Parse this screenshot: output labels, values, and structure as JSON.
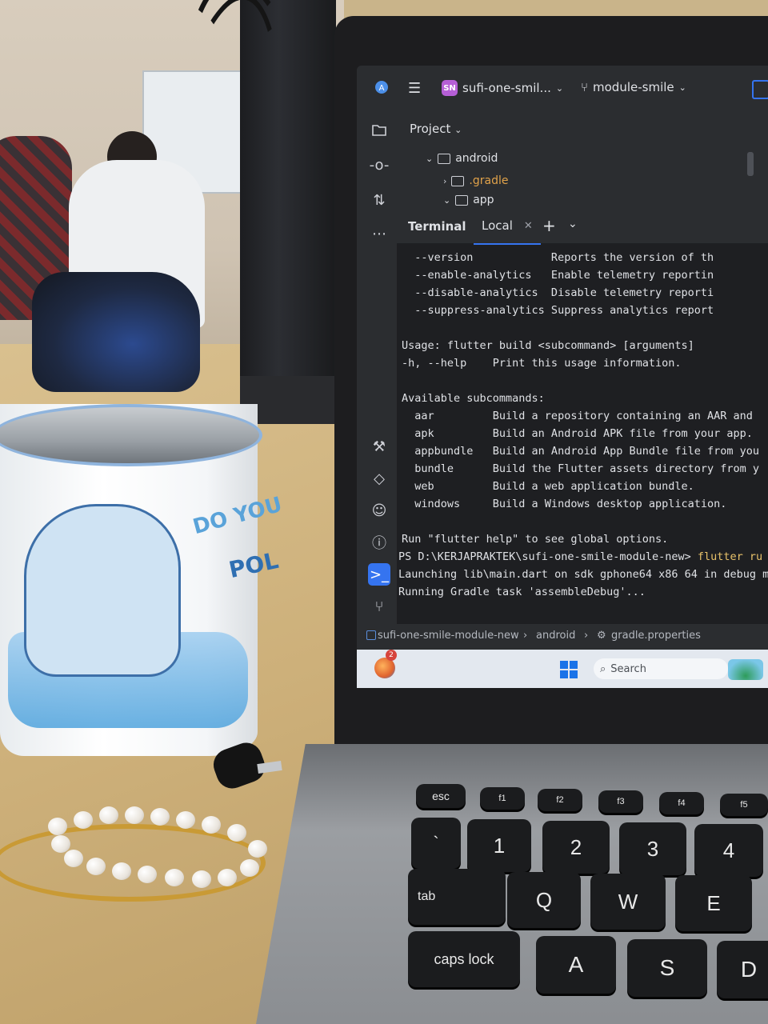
{
  "topbar": {
    "project_initials": "SN",
    "project_name": "sufi-one-smil...",
    "branch": "module-smile"
  },
  "project_panel": {
    "title": "Project",
    "tree": [
      "android",
      ".gradle",
      "app"
    ]
  },
  "terminal": {
    "title": "Terminal",
    "tab_label": "Local",
    "lines": [
      {
        "text": "  --version            Reports the version of th"
      },
      {
        "text": "  --enable-analytics   Enable telemetry reportin"
      },
      {
        "text": "  --disable-analytics  Disable telemetry reporti"
      },
      {
        "text": "  --suppress-analytics Suppress analytics report"
      },
      {
        "text": ""
      },
      {
        "text": "Usage: flutter build <subcommand> [arguments]"
      },
      {
        "text": "-h, --help    Print this usage information."
      },
      {
        "text": ""
      },
      {
        "text": "Available subcommands:"
      },
      {
        "text": "  aar         Build a repository containing an AAR and"
      },
      {
        "text": "  apk         Build an Android APK file from your app."
      },
      {
        "text": "  appbundle   Build an Android App Bundle file from you"
      },
      {
        "text": "  bundle      Build the Flutter assets directory from y"
      },
      {
        "text": "  web         Build a web application bundle."
      },
      {
        "text": "  windows     Build a Windows desktop application."
      },
      {
        "text": ""
      },
      {
        "text": "Run \"flutter help\" to see global options."
      }
    ],
    "prompt": "PS D:\\KERJAPRAKTEK\\sufi-one-smile-module-new>",
    "command": "flutter ru",
    "launching": "Launching lib\\main.dart on sdk gphone64 x86 64 in debug m",
    "running": "Running Gradle task 'assembleDebug'..."
  },
  "statusbar": {
    "crumbs": [
      "sufi-one-smile-module-new",
      "android",
      "gradle.properties"
    ]
  },
  "taskbar": {
    "notification_count": "2",
    "search_placeholder": "Search"
  },
  "mug": {
    "text_line1": "DO YOU",
    "text_line2": "POL"
  },
  "keyboard": {
    "row_fn": [
      "esc",
      "f1",
      "f2",
      "f3",
      "f4",
      "f5"
    ],
    "row_num": [
      "`",
      "1",
      "2",
      "3",
      "4"
    ],
    "row_num_shift": [
      "~",
      "!",
      "@",
      "#",
      "$"
    ],
    "row_q": [
      "tab",
      "Q",
      "W",
      "E"
    ],
    "row_a": [
      "caps lock",
      "A",
      "S",
      "D"
    ]
  },
  "colors": {
    "ide_bg": "#2b2d30",
    "terminal_bg": "#1e1f22",
    "accent": "#3574f0",
    "command_highlight": "#e8c26a"
  }
}
